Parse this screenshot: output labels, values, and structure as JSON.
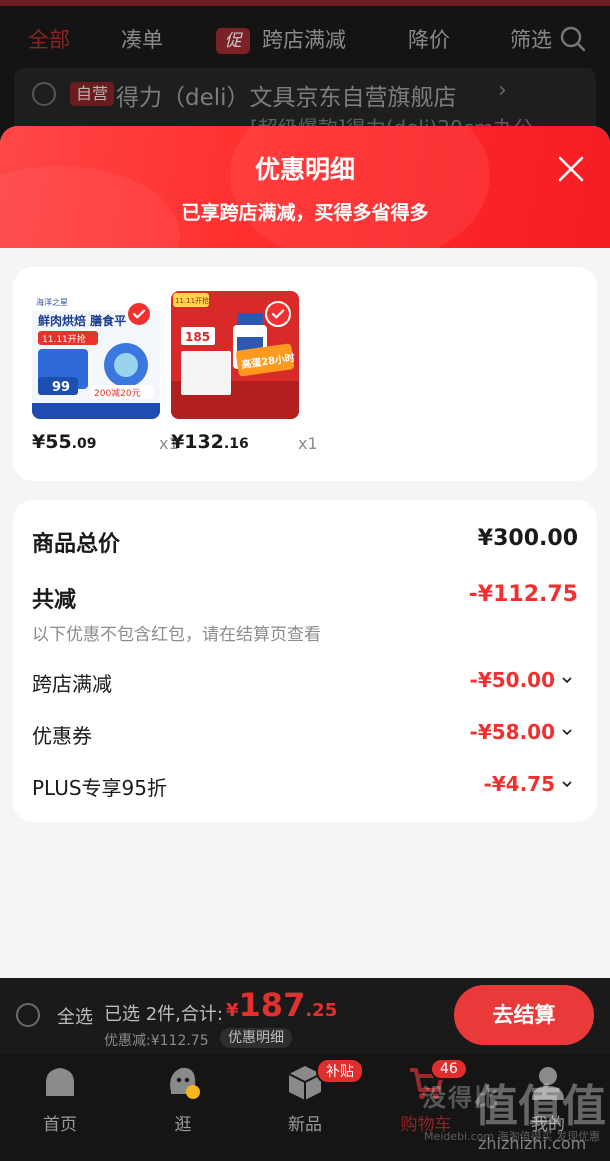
{
  "filter_bar": {
    "items": [
      "全部",
      "凑单",
      "跨店满减",
      "降价",
      "筛选"
    ],
    "promo_tag": "促"
  },
  "shop": {
    "badge": "自营",
    "name": "得力（deli）文具京东自营旗舰店",
    "subtitle": "[超级爆款]得力(deli)20cm办公"
  },
  "sheet": {
    "title": "优惠明细",
    "subtitle": "已享跨店满减，买得多省得多"
  },
  "products": [
    {
      "price_int": "¥55",
      "price_dec": ".09",
      "qty": "x1",
      "thumb_text": "鲜肉烘焙 膳食平",
      "thumb_brand": "海洋之星",
      "thumb_tag": "11.11开抢",
      "thumb_price": "99",
      "thumb_coupon": "200减20元"
    },
    {
      "price_int": "¥132",
      "price_dec": ".16",
      "qty": "x1",
      "thumb_text": "高蛋28小时",
      "thumb_tag": "11.11开抢",
      "thumb_price": "185"
    }
  ],
  "summary": {
    "total_label": "商品总价",
    "total_amount": "¥300.00",
    "reduce_label": "共减",
    "reduce_amount": "-¥112.75",
    "note": "以下优惠不包含红包，请在结算页查看",
    "rows": [
      {
        "label": "跨店满减",
        "amount": "-¥50.00"
      },
      {
        "label": "优惠券",
        "amount": "-¥58.00"
      },
      {
        "label": "PLUS专享95折",
        "amount": "-¥4.75"
      }
    ]
  },
  "checkout": {
    "select_all": "全选",
    "selected_info": "已选 2件,合计:",
    "total_sym": "¥",
    "total_int": "187",
    "total_dec": ".25",
    "discount_line": "优惠减:¥112.75",
    "detail_chip": "优惠明细",
    "button": "去结算"
  },
  "tabs": [
    {
      "label": "首页",
      "icon": "home-icon"
    },
    {
      "label": "逛",
      "icon": "explore-icon"
    },
    {
      "label": "新品",
      "icon": "cube-icon",
      "badge": "补贴"
    },
    {
      "label": "购物车",
      "icon": "cart-icon",
      "badge": "46"
    },
    {
      "label": "我的",
      "icon": "profile-icon"
    }
  ],
  "watermark": {
    "text": "没得比",
    "sub": "Meidebi.com 海淘值得买 发现优惠",
    "big": "值值值",
    "url": "zhizhizhi.com"
  },
  "colors": {
    "accent_red": "#f23030",
    "header_red": "#ff2a2a",
    "checkout_btn": "#e93939"
  }
}
